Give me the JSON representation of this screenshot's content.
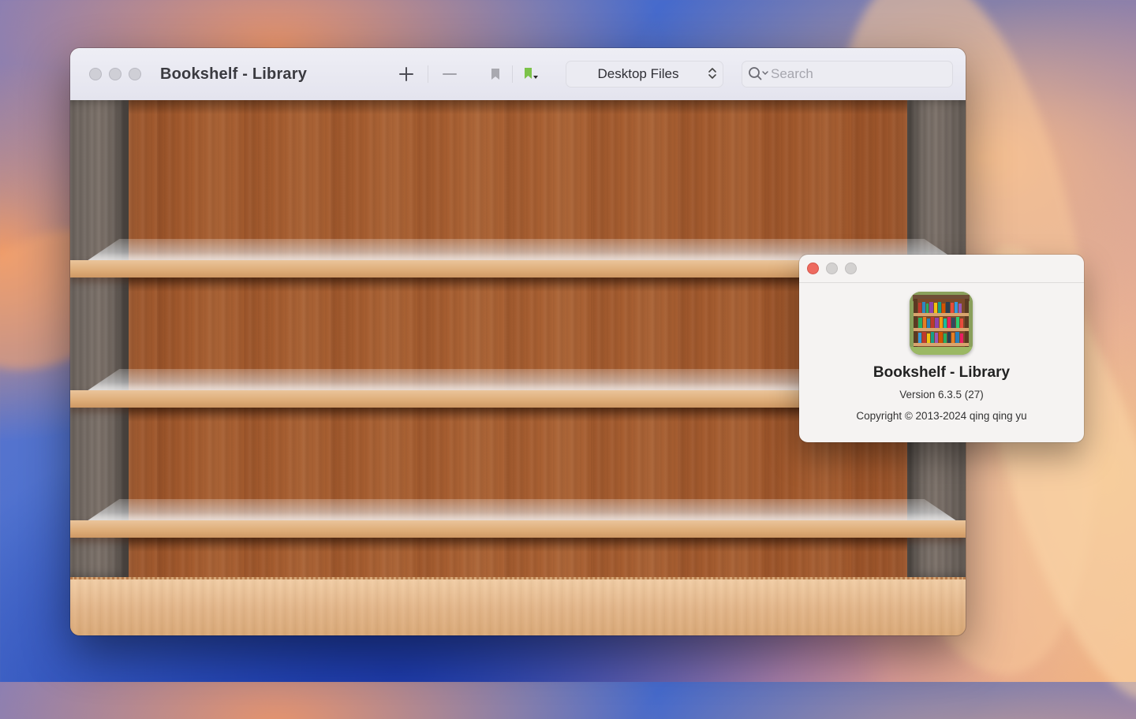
{
  "main_window": {
    "title": "Bookshelf - Library",
    "toolbar": {
      "add_icon": "plus-icon",
      "remove_icon": "minus-icon",
      "bookmark_icon": "bookmark-icon",
      "bookmark_menu_icon": "bookmark-menu-icon",
      "source_popup_value": "Desktop Files",
      "search_placeholder": "Search",
      "search_value": ""
    },
    "shelf_count": 4
  },
  "about_window": {
    "app_name": "Bookshelf - Library",
    "version": "Version 6.3.5 (27)",
    "copyright": "Copyright © 2013-2024 qing qing yu",
    "icon": "bookshelf-app-icon"
  },
  "colors": {
    "close_red": "#ee6a5f",
    "bookmark_green": "#7cc24a",
    "wood_back": "#a35a2d",
    "plank": "#dfae7a"
  }
}
